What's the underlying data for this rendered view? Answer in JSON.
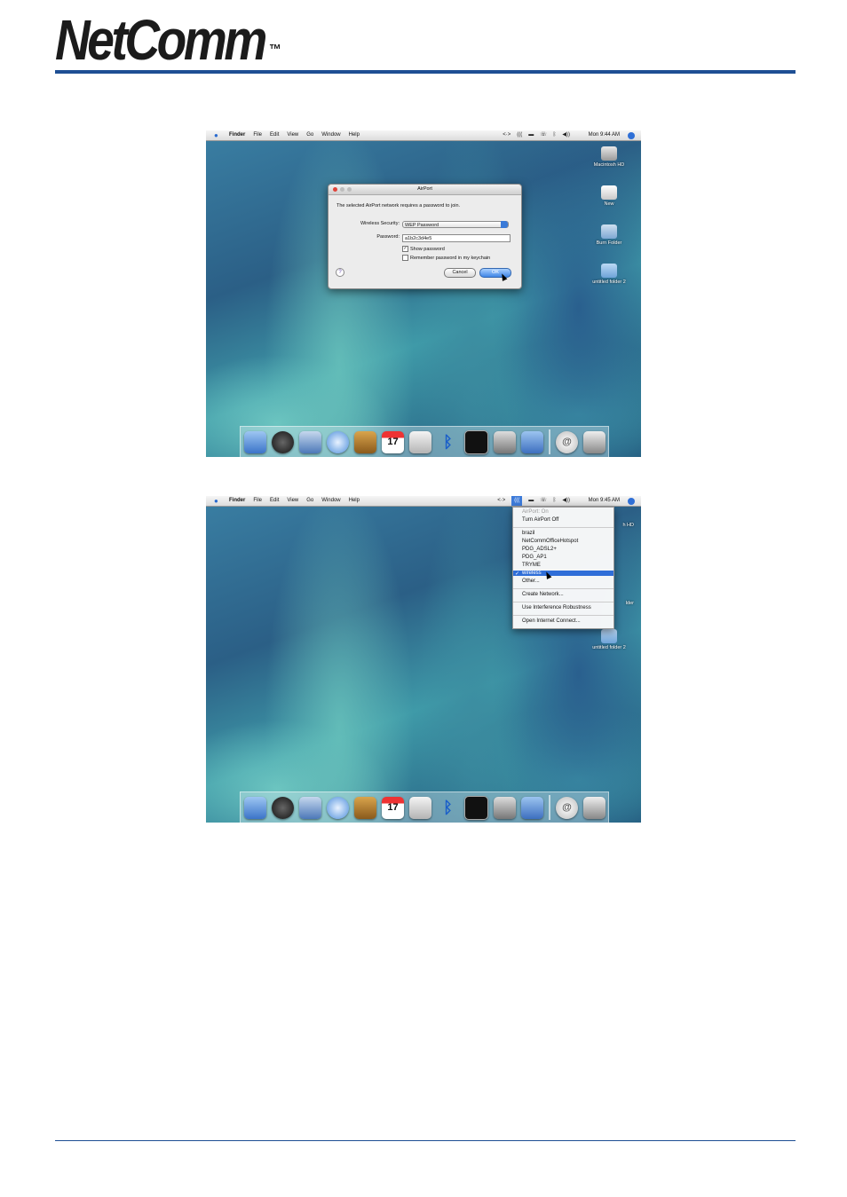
{
  "logo": {
    "text": "NetComm",
    "tm": "™"
  },
  "screen1": {
    "menubar": {
      "apple": "",
      "menus": [
        "Finder",
        "File",
        "Edit",
        "View",
        "Go",
        "Window",
        "Help"
      ],
      "status": [
        "<·>",
        "(((",
        "▬",
        "☏",
        "ᛒ",
        "◀))"
      ],
      "clock": "Mon 9:44 AM"
    },
    "desktop_icons": [
      "Macintosh HD",
      "New",
      "Burn Folder",
      "untitled folder 2"
    ],
    "dialog": {
      "title": "AirPort",
      "message": "The selected AirPort network requires a password to join.",
      "security_label": "Wireless Security:",
      "security_value": "WEP Password",
      "password_label": "Password:",
      "password_value": "a1b2c3d4e5",
      "show_password": "Show password",
      "remember_password": "Remember password in my keychain",
      "help": "?",
      "cancel": "Cancel",
      "ok": "OK"
    }
  },
  "screen2": {
    "menubar": {
      "apple": "",
      "menus": [
        "Finder",
        "File",
        "Edit",
        "View",
        "Go",
        "Window",
        "Help"
      ],
      "status": [
        "<·>",
        "(((",
        "▬",
        "☏",
        "ᛒ",
        "◀))"
      ],
      "clock": "Mon 9:45 AM"
    },
    "desktop_icons": [
      "h HD",
      "lder",
      "untitled folder 2"
    ],
    "airport_menu": {
      "status": "AirPort: On",
      "toggle": "Turn AirPort Off",
      "networks": [
        "brazil",
        "NetCommOfficeHotspot",
        "PDG_ADSL2+",
        "PDG_AP1",
        "TRYME"
      ],
      "selected": "wireless",
      "tick": "✓",
      "other": "Other...",
      "create": "Create Network...",
      "interference": "Use Interference Robustness",
      "open_connect": "Open Internet Connect..."
    }
  },
  "dock_items": [
    "Finder",
    "Dashboard",
    "Mail",
    "Safari",
    "Address Book",
    "iCal",
    "Preview",
    "Bluetooth",
    "Terminal",
    "Photo Browser",
    "Image Capture",
    "Mail Server",
    "Trash"
  ],
  "dock_glyphs": {
    "ical_date": "17",
    "at": "@",
    "bt": "ᛒ"
  }
}
